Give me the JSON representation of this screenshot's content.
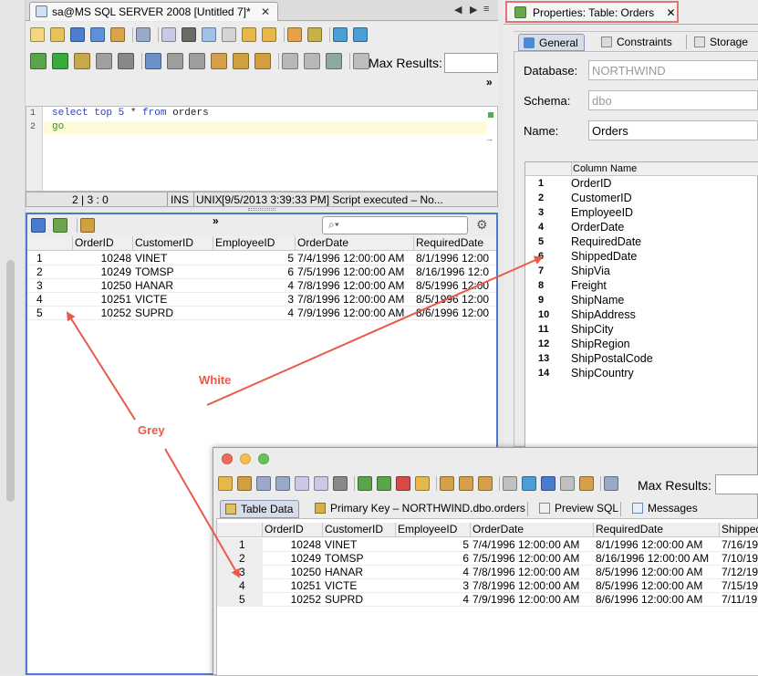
{
  "editor_tab": {
    "title": "sa@MS SQL SERVER 2008 [Untitled 7]*"
  },
  "toolbar": {
    "max_results_label": "Max Results:",
    "overflow": "»"
  },
  "editor": {
    "lines": [
      {
        "num": "1",
        "kw1": "select",
        "kw2": "top",
        "num_lit": "5",
        "star": "*",
        "kw3": "from",
        "tail": "orders"
      },
      {
        "num": "2",
        "go": "go"
      }
    ]
  },
  "statusbar": {
    "position": "2 | 3 : 0",
    "mode": "INS",
    "eol": "UNIX",
    "message": "[9/5/2013 3:39:33 PM] Script executed – No..."
  },
  "results": {
    "overflow": "»",
    "search_placeholder": "",
    "columns": [
      "OrderID",
      "CustomerID",
      "EmployeeID",
      "OrderDate",
      "RequiredDate"
    ],
    "rows": [
      {
        "n": "1",
        "id": "10248",
        "cust": "VINET",
        "emp": "5",
        "odate": "7/4/1996 12:00:00 AM",
        "rdate": "8/1/1996 12:00"
      },
      {
        "n": "2",
        "id": "10249",
        "cust": "TOMSP",
        "emp": "6",
        "odate": "7/5/1996 12:00:00 AM",
        "rdate": "8/16/1996 12:0"
      },
      {
        "n": "3",
        "id": "10250",
        "cust": "HANAR",
        "emp": "4",
        "odate": "7/8/1996 12:00:00 AM",
        "rdate": "8/5/1996 12:00"
      },
      {
        "n": "4",
        "id": "10251",
        "cust": "VICTE",
        "emp": "3",
        "odate": "7/8/1996 12:00:00 AM",
        "rdate": "8/5/1996 12:00"
      },
      {
        "n": "5",
        "id": "10252",
        "cust": "SUPRD",
        "emp": "4",
        "odate": "7/9/1996 12:00:00 AM",
        "rdate": "8/6/1996 12:00"
      }
    ]
  },
  "properties": {
    "tab_title": "Properties: Table: Orders",
    "subtabs": [
      "General",
      "Constraints",
      "Storage"
    ],
    "database_label": "Database:",
    "database_value": "NORTHWIND",
    "schema_label": "Schema:",
    "schema_value": "dbo",
    "name_label": "Name:",
    "name_value": "Orders",
    "column_header": "Column Name",
    "columns": [
      {
        "n": "1",
        "name": "OrderID"
      },
      {
        "n": "2",
        "name": "CustomerID"
      },
      {
        "n": "3",
        "name": "EmployeeID"
      },
      {
        "n": "4",
        "name": "OrderDate"
      },
      {
        "n": "5",
        "name": "RequiredDate"
      },
      {
        "n": "6",
        "name": "ShippedDate"
      },
      {
        "n": "7",
        "name": "ShipVia"
      },
      {
        "n": "8",
        "name": "Freight"
      },
      {
        "n": "9",
        "name": "ShipName"
      },
      {
        "n": "10",
        "name": "ShipAddress"
      },
      {
        "n": "11",
        "name": "ShipCity"
      },
      {
        "n": "12",
        "name": "ShipRegion"
      },
      {
        "n": "13",
        "name": "ShipPostalCode"
      },
      {
        "n": "14",
        "name": "ShipCountry"
      }
    ]
  },
  "popup": {
    "max_results_label": "Max Results:",
    "tabs": [
      "Table Data",
      "Primary Key – NORTHWIND.dbo.orders",
      "Preview SQL",
      "Messages"
    ],
    "columns": [
      "OrderID",
      "CustomerID",
      "EmployeeID",
      "OrderDate",
      "RequiredDate",
      "Shipped"
    ],
    "rows": [
      {
        "n": "1",
        "id": "10248",
        "cust": "VINET",
        "emp": "5",
        "odate": "7/4/1996 12:00:00 AM",
        "rdate": "8/1/1996 12:00:00 AM",
        "sdate": "7/16/19"
      },
      {
        "n": "2",
        "id": "10249",
        "cust": "TOMSP",
        "emp": "6",
        "odate": "7/5/1996 12:00:00 AM",
        "rdate": "8/16/1996 12:00:00 AM",
        "sdate": "7/10/19"
      },
      {
        "n": "3",
        "id": "10250",
        "cust": "HANAR",
        "emp": "4",
        "odate": "7/8/1996 12:00:00 AM",
        "rdate": "8/5/1996 12:00:00 AM",
        "sdate": "7/12/19"
      },
      {
        "n": "4",
        "id": "10251",
        "cust": "VICTE",
        "emp": "3",
        "odate": "7/8/1996 12:00:00 AM",
        "rdate": "8/5/1996 12:00:00 AM",
        "sdate": "7/15/19"
      },
      {
        "n": "5",
        "id": "10252",
        "cust": "SUPRD",
        "emp": "4",
        "odate": "7/9/1996 12:00:00 AM",
        "rdate": "8/6/1996 12:00:00 AM",
        "sdate": "7/11/19"
      }
    ]
  },
  "annotations": {
    "white": "White",
    "grey": "Grey",
    "arrow_color": "#ea5a4a",
    "highlight_color": "#e57370"
  }
}
